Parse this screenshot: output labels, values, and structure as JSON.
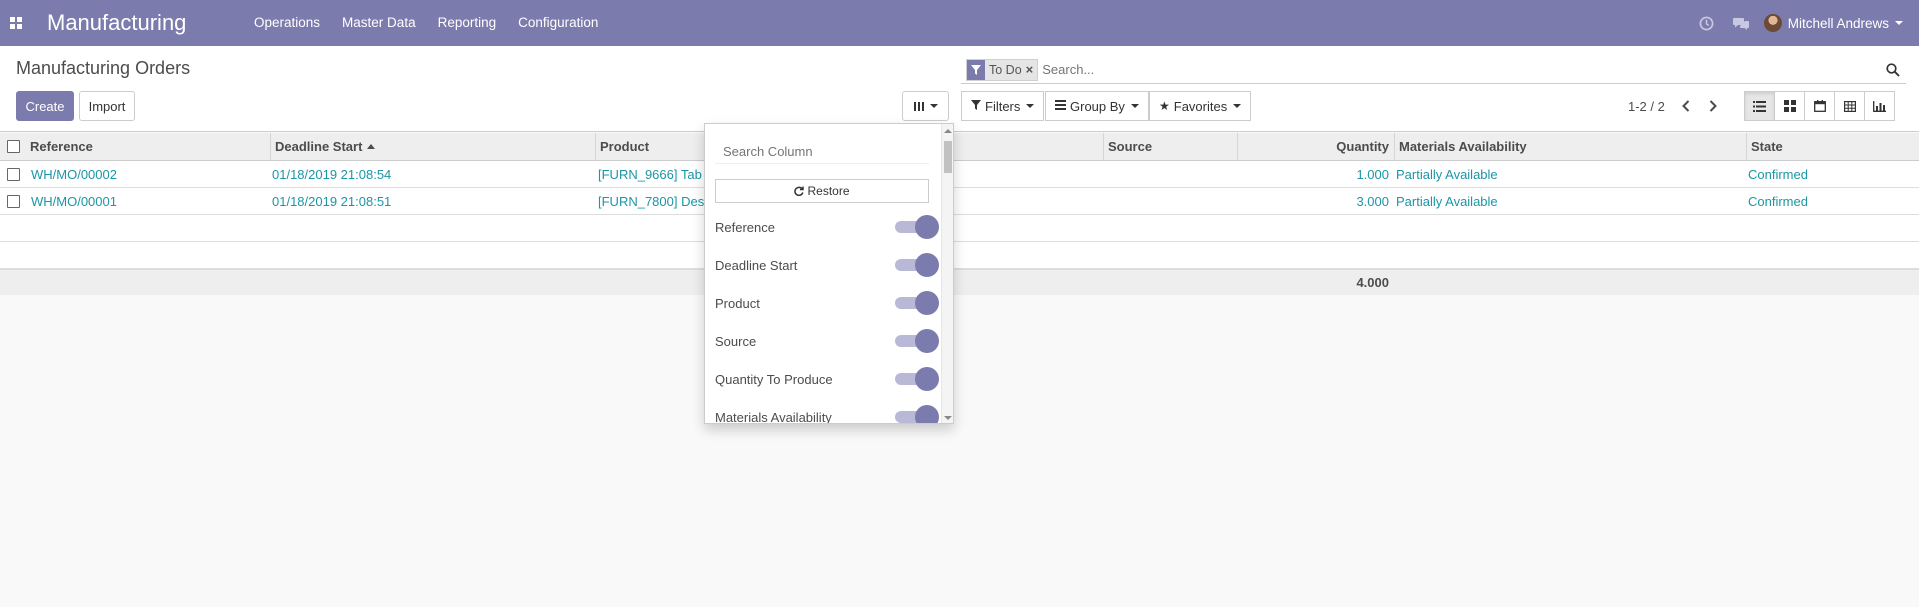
{
  "topbar": {
    "app_title": "Manufacturing",
    "menu": [
      "Operations",
      "Master Data",
      "Reporting",
      "Configuration"
    ],
    "user_name": "Mitchell Andrews",
    "color": "#7c7bad"
  },
  "control": {
    "breadcrumb": "Manufacturing Orders",
    "create_label": "Create",
    "import_label": "Import",
    "search": {
      "facet": "To Do",
      "placeholder": "Search..."
    },
    "filters_label": "Filters",
    "groupby_label": "Group By",
    "favorites_label": "Favorites",
    "pager": "1-2 / 2"
  },
  "table": {
    "headers": {
      "reference": "Reference",
      "deadline": "Deadline Start",
      "product": "Product",
      "source": "Source",
      "quantity": "Quantity",
      "materials": "Materials Availability",
      "state": "State"
    },
    "rows": [
      {
        "reference": "WH/MO/00002",
        "deadline": "01/18/2019 21:08:54",
        "product": "[FURN_9666] Tab",
        "quantity": "1.000",
        "materials": "Partially Available",
        "state": "Confirmed"
      },
      {
        "reference": "WH/MO/00001",
        "deadline": "01/18/2019 21:08:51",
        "product": "[FURN_7800] Des",
        "quantity": "3.000",
        "materials": "Partially Available",
        "state": "Confirmed"
      }
    ],
    "total_quantity": "4.000"
  },
  "column_selector": {
    "search_placeholder": "Search Column",
    "restore_label": "Restore",
    "items": [
      "Reference",
      "Deadline Start",
      "Product",
      "Source",
      "Quantity To Produce",
      "Materials Availability"
    ]
  }
}
